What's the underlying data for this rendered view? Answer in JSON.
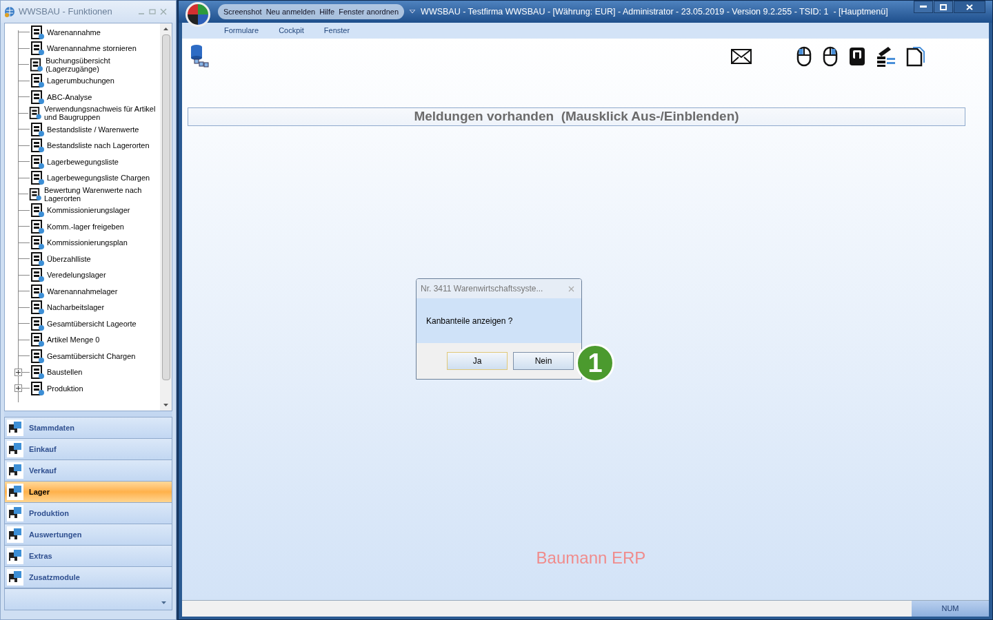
{
  "left_panel": {
    "title": "WWSBAU - Funktionen",
    "tree": [
      {
        "kind": "leaf",
        "label": "Warenannahme"
      },
      {
        "kind": "leaf",
        "label": "Warenannahme stornieren"
      },
      {
        "kind": "leaf",
        "label": "Buchungsübersicht (Lagerzugänge)"
      },
      {
        "kind": "leaf",
        "label": "Lagerumbuchungen"
      },
      {
        "kind": "leaf",
        "label": "ABC-Analyse"
      },
      {
        "kind": "leaf",
        "label": "Verwendungsnachweis für Artikel und Baugruppen"
      },
      {
        "kind": "leaf",
        "label": "Bestandsliste / Warenwerte"
      },
      {
        "kind": "leaf",
        "label": "Bestandsliste nach Lagerorten"
      },
      {
        "kind": "leaf",
        "label": "Lagerbewegungsliste"
      },
      {
        "kind": "leaf",
        "label": "Lagerbewegungsliste Chargen"
      },
      {
        "kind": "leaf",
        "label": "Bewertung Warenwerte nach Lagerorten"
      },
      {
        "kind": "leaf",
        "label": "Kommissionierungslager"
      },
      {
        "kind": "leaf",
        "label": "Komm.-lager freigeben"
      },
      {
        "kind": "leaf",
        "label": "Kommissionierungsplan"
      },
      {
        "kind": "leaf",
        "label": "Überzahlliste"
      },
      {
        "kind": "leaf",
        "label": "Veredelungslager"
      },
      {
        "kind": "leaf",
        "label": "Warenannahmelager"
      },
      {
        "kind": "leaf",
        "label": "Nacharbeitslager"
      },
      {
        "kind": "leaf",
        "label": "Gesamtübersicht Lageorte"
      },
      {
        "kind": "leaf",
        "label": "Artikel Menge 0"
      },
      {
        "kind": "leaf",
        "label": "Gesamtübersicht Chargen"
      },
      {
        "kind": "folder",
        "label": "Baustellen",
        "expanded": false
      },
      {
        "kind": "folder",
        "label": "Produktion",
        "expanded": false
      }
    ],
    "nav": [
      {
        "label": "Stammdaten",
        "selected": false
      },
      {
        "label": "Einkauf",
        "selected": false
      },
      {
        "label": "Verkauf",
        "selected": false
      },
      {
        "label": "Lager",
        "selected": true
      },
      {
        "label": "Produktion",
        "selected": false
      },
      {
        "label": "Auswertungen",
        "selected": false
      },
      {
        "label": "Extras",
        "selected": false
      },
      {
        "label": "Zusatzmodule",
        "selected": false
      }
    ]
  },
  "main_window": {
    "quick_menu": [
      "Screenshot",
      "Neu anmelden",
      "Hilfe",
      "Fenster anordnen"
    ],
    "title": "WWSBAU - Testfirma WWSBAU - [Währung: EUR] - Administrator - 23.05.2019 - Version 9.2.255 - TSID: 1  - [Hauptmenü]",
    "menu": [
      "Formulare",
      "Cockpit",
      "Fenster"
    ],
    "message_bar": "Meldungen vorhanden  (Mausklick Aus-/Einblenden)",
    "brand": "Baumann ERP",
    "status_bar": {
      "indicator": "NUM"
    }
  },
  "dialog": {
    "title": "Nr. 3411 Warenwirtschaftssyste...",
    "message": "Kanbanteile anzeigen ?",
    "buttons": [
      {
        "label": "Ja",
        "focused": true
      },
      {
        "label": "Nein",
        "focused": false
      }
    ]
  },
  "callout": "1"
}
